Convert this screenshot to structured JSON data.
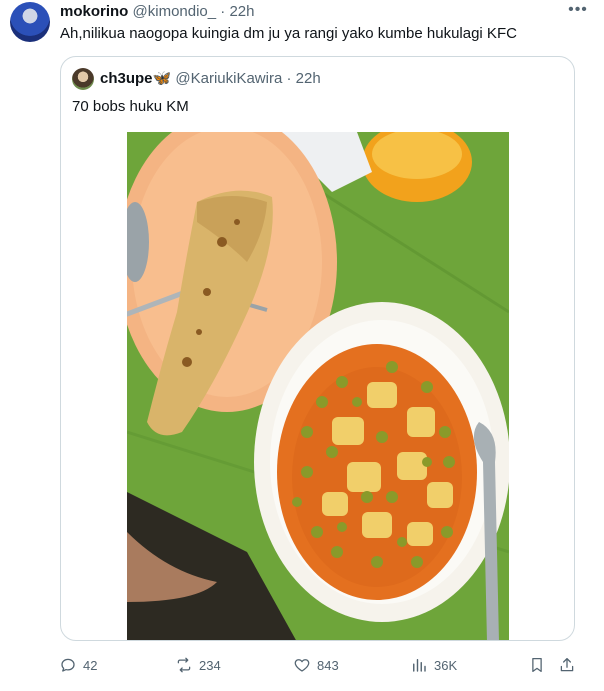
{
  "tweet": {
    "author_name": "mokorino",
    "author_handle": "@kimondio_",
    "separator": "·",
    "time": "22h",
    "text": "Ah,nilikua naogopa kuingia dm ju ya rangi yako kumbe hukulagi KFC",
    "more_icon": "more-horizontal-icon"
  },
  "quote": {
    "author_name": "ch3upe",
    "author_badge": "🦋",
    "author_handle": "@KariukiKawira",
    "separator": "·",
    "time": "22h",
    "text": "70 bobs huku KM",
    "image": "photo-chapati-and-peas-stew"
  },
  "actions": {
    "replies": "42",
    "reposts": "234",
    "likes": "843",
    "views": "36K",
    "reply_icon": "reply-icon",
    "repost_icon": "repost-icon",
    "like_icon": "heart-icon",
    "views_icon": "views-icon",
    "bookmark_icon": "bookmark-icon",
    "share_icon": "share-icon"
  }
}
